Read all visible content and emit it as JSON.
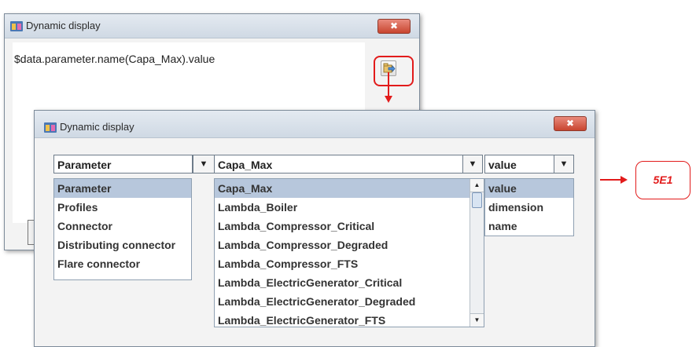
{
  "window_main": {
    "title": "Dynamic display",
    "close_symbol": "✖",
    "expression": "$data.parameter.name(Capa_Max).value",
    "expression_button_icon": "expression-editor-icon"
  },
  "window_picker": {
    "title": "Dynamic display",
    "close_symbol": "✖",
    "combo_category": "Parameter",
    "combo_name": "Capa_Max",
    "combo_property": "value",
    "dropdown_arrow": "▼",
    "category_items": [
      "Parameter",
      "Profiles",
      "Connector",
      "Distributing connector",
      "Flare connector"
    ],
    "name_items": [
      "Capa_Max",
      "Lambda_Boiler",
      "Lambda_Compressor_Critical",
      "Lambda_Compressor_Degraded",
      "Lambda_Compressor_FTS",
      "Lambda_ElectricGenerator_Critical",
      "Lambda_ElectricGenerator_Degraded",
      "Lambda_ElectricGenerator_FTS"
    ],
    "property_items": [
      "value",
      "dimension",
      "name"
    ],
    "scroll_up": "▲",
    "scroll_down": "▼"
  },
  "callout": {
    "label": "5E1",
    "color": "#e21b1b"
  },
  "colors": {
    "accent_red": "#e21b1b",
    "selection": "#b7c7dc",
    "titlebar": "#cfd9e4"
  }
}
